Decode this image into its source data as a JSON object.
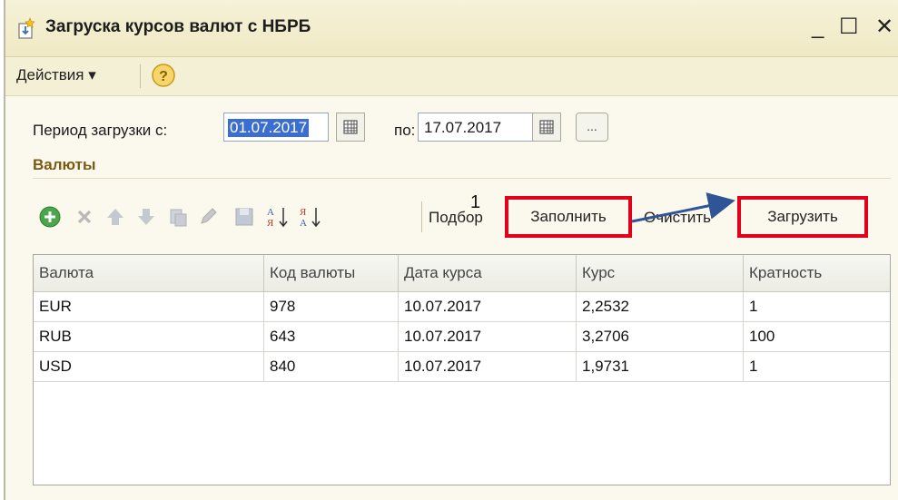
{
  "window": {
    "title": "Загруска курсов валют с НБРБ",
    "minimize": "_",
    "maximize": "☐",
    "close": "✕"
  },
  "menu": {
    "actions_label": "Действия ▾",
    "help_icon": "help-icon"
  },
  "period": {
    "label": "Период загрузки с:",
    "from": "01.07.2017",
    "to_label": "по:",
    "to": "17.07.2017",
    "more_button": "..."
  },
  "currencies_section": {
    "title": "Валюты"
  },
  "toolbar": {
    "icons": [
      "add-icon",
      "delete-icon",
      "move-up-icon",
      "move-down-icon",
      "copy-icon",
      "edit-icon",
      "save-icon",
      "sort-asc-icon",
      "sort-desc-icon"
    ],
    "pick_label": "Подбор",
    "fill_label": "Заполнить",
    "clear_label": "Очистить",
    "load_label": "Загрузить",
    "annotation_number": "1",
    "highlight_color": "#e3001b",
    "arrow_color": "#2f5597"
  },
  "table": {
    "columns": [
      "Валюта",
      "Код валюты",
      "Дата курса",
      "Курс",
      "Кратность"
    ],
    "rows": [
      [
        "EUR",
        "978",
        "10.07.2017",
        "2,2532",
        "1"
      ],
      [
        "RUB",
        "643",
        "10.07.2017",
        "3,2706",
        "100"
      ],
      [
        "USD",
        "840",
        "10.07.2017",
        "1,9731",
        "1"
      ]
    ]
  }
}
